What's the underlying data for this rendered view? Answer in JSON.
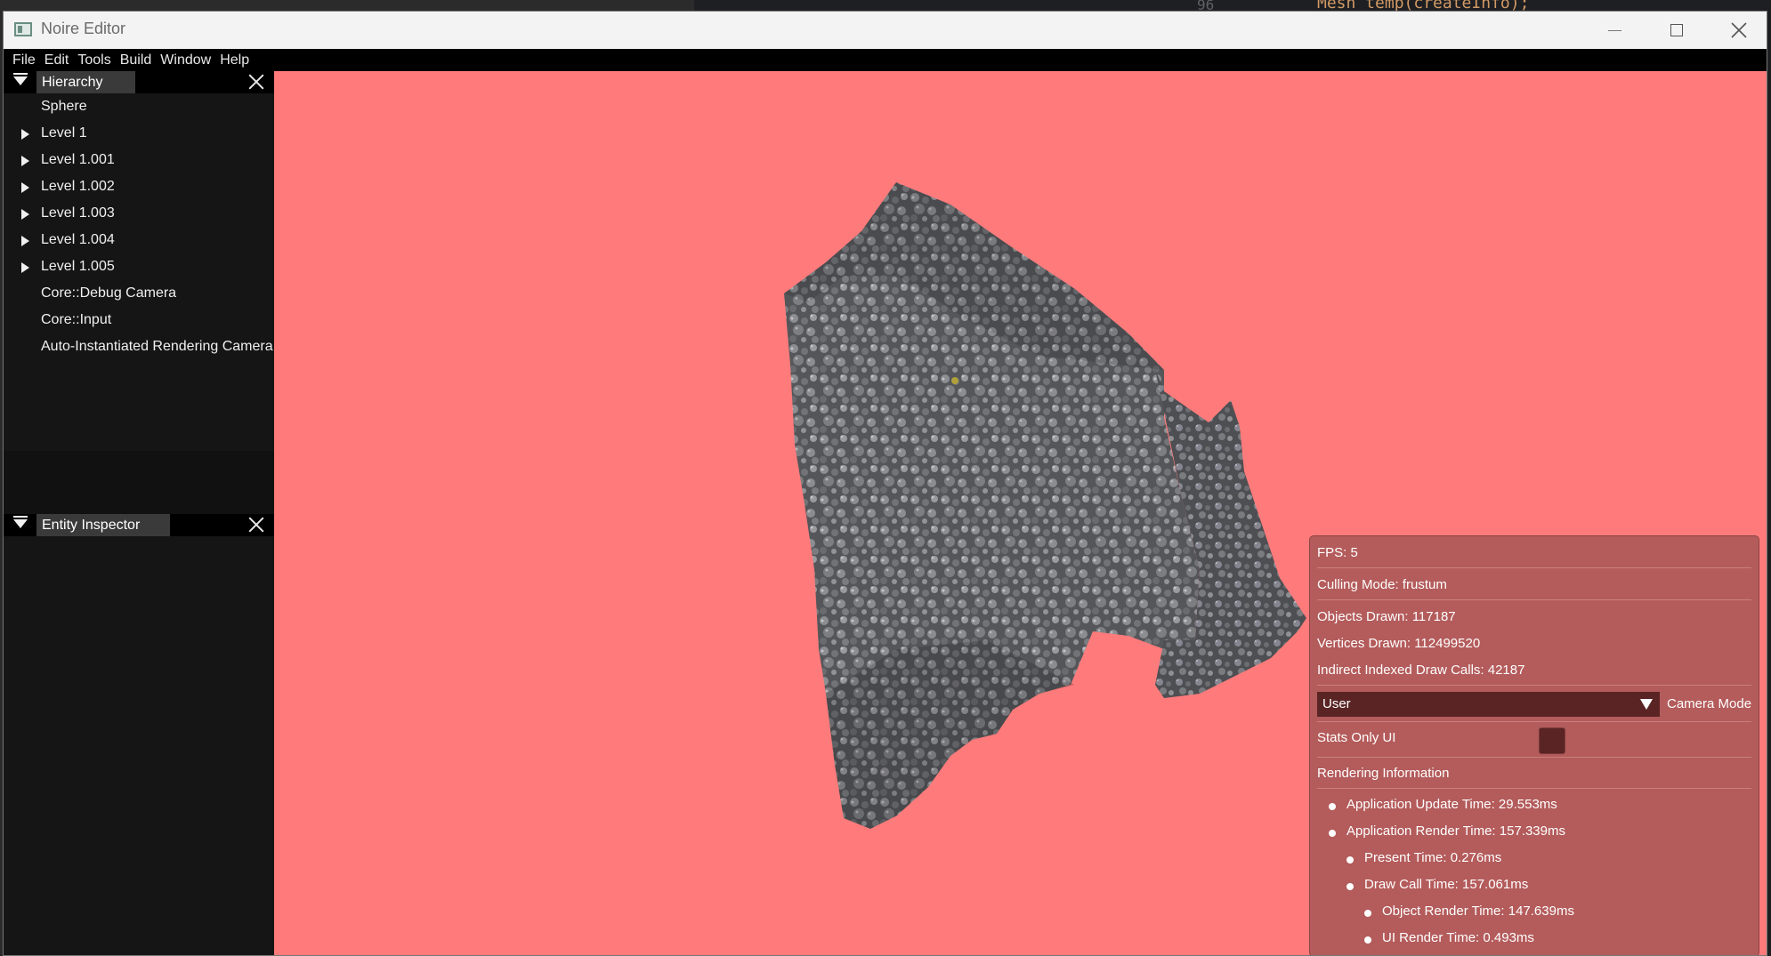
{
  "background_editor": {
    "line_number": "96",
    "code_fragment": "Mesh temp(createInfo);"
  },
  "window": {
    "title": "Noire Editor"
  },
  "menu": [
    "File",
    "Edit",
    "Tools",
    "Build",
    "Window",
    "Help"
  ],
  "hierarchy": {
    "title": "Hierarchy",
    "items": [
      {
        "label": "Sphere",
        "expandable": false
      },
      {
        "label": "Level 1",
        "expandable": true
      },
      {
        "label": "Level 1.001",
        "expandable": true
      },
      {
        "label": "Level 1.002",
        "expandable": true
      },
      {
        "label": "Level 1.003",
        "expandable": true
      },
      {
        "label": "Level 1.004",
        "expandable": true
      },
      {
        "label": "Level 1.005",
        "expandable": true
      },
      {
        "label": "Core::Debug Camera",
        "expandable": false
      },
      {
        "label": "Core::Input",
        "expandable": false
      },
      {
        "label": "Auto-Instantiated Rendering Camera",
        "expandable": false
      }
    ]
  },
  "inspector": {
    "title": "Entity Inspector"
  },
  "viewport": {
    "background_color": "#ff7b7b"
  },
  "stats": {
    "fps": "FPS: 5",
    "culling_mode": "Culling Mode: frustum",
    "objects_drawn": "Objects Drawn: 117187",
    "vertices_drawn": "Vertices Drawn: 112499520",
    "draw_calls": "Indirect Indexed Draw Calls: 42187",
    "camera_mode_value": "User",
    "camera_mode_label": "Camera Mode",
    "stats_only_label": "Stats Only UI",
    "stats_only_checked": false,
    "rendering_header": "Rendering Information",
    "app_update": "Application Update Time: 29.553ms",
    "app_render": "Application Render Time: 157.339ms",
    "present": "Present Time: 0.276ms",
    "draw_call_time": "Draw Call Time: 157.061ms",
    "object_render": "Object Render Time: 147.639ms",
    "ui_render": "UI Render Time: 0.493ms"
  }
}
